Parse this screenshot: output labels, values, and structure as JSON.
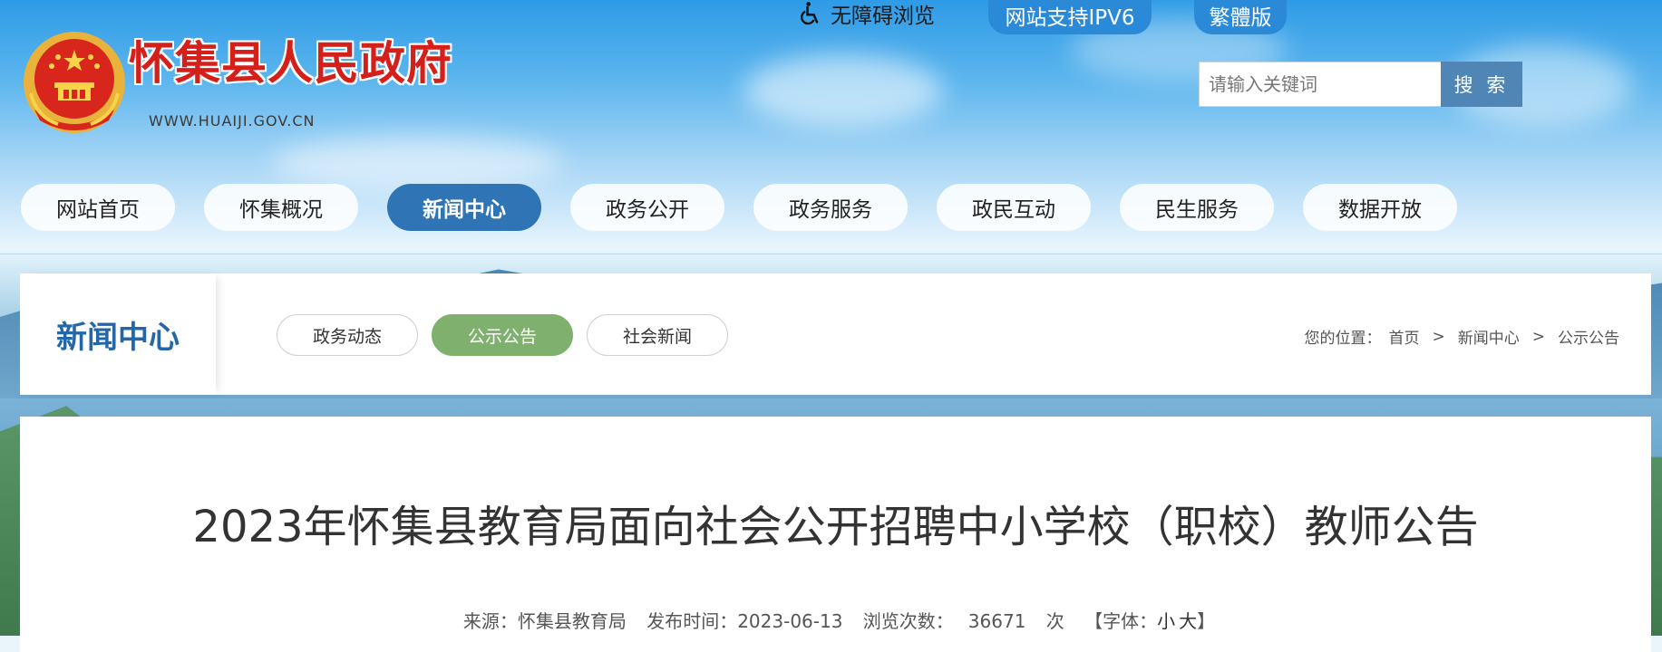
{
  "header": {
    "site_title": "怀集县人民政府",
    "site_url": "WWW.HUAIJI.GOV.CN",
    "accessibility_label": "无障碍浏览",
    "ipv6_label": "网站支持IPV6",
    "traditional_label": "繁體版",
    "search": {
      "placeholder": "请输入关键词",
      "button_label": "搜 索"
    }
  },
  "nav": {
    "items": [
      "网站首页",
      "怀集概况",
      "新闻中心",
      "政务公开",
      "政务服务",
      "政民互动",
      "民生服务",
      "数据开放"
    ],
    "active_index": 2
  },
  "subbar": {
    "section_title": "新闻中心",
    "tabs": [
      "政务动态",
      "公示公告",
      "社会新闻"
    ],
    "active_tab_index": 1,
    "breadcrumb": {
      "label": "您的位置：",
      "items": [
        "首页",
        "新闻中心",
        "公示公告"
      ],
      "separator": ">"
    }
  },
  "article": {
    "title": "2023年怀集县教育局面向社会公开招聘中小学校（职校）教师公告",
    "source": "来源：怀集县教育局",
    "publish_time": "发布时间：2023-06-13",
    "views_label": "浏览次数：",
    "views": "36671",
    "views_unit": "次",
    "font_label": "【字体：",
    "font_small": "小",
    "font_large": "大",
    "font_close": "】"
  },
  "colors": {
    "title_red": "#d41f1a",
    "nav_active": "#2f74b5",
    "tab_active": "#7fb06d",
    "section_title": "#2467a8",
    "search_button": "#4f86b6"
  }
}
